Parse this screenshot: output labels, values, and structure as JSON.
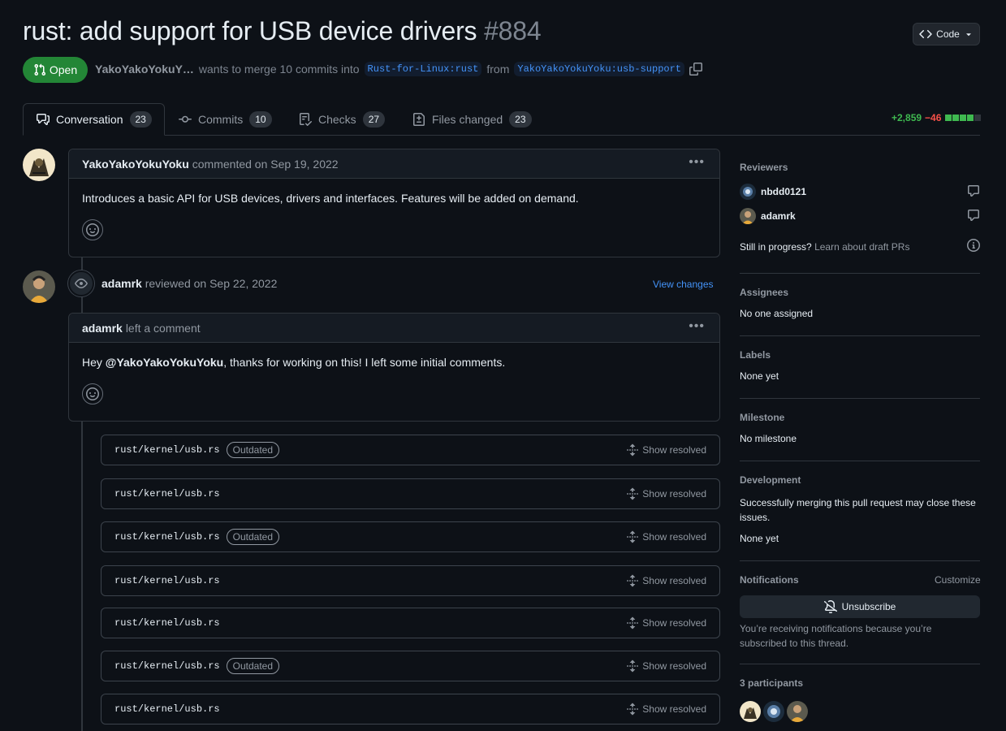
{
  "pr": {
    "title": "rust: add support for USB device drivers",
    "number": "#884",
    "state": "Open",
    "author": "YakoYakoYokuY…",
    "merge_text": "wants to merge 10 commits into",
    "base_branch": "Rust-for-Linux:rust",
    "from_text": "from",
    "head_branch": "YakoYakoYokuYoku:usb-support",
    "code_button": "Code"
  },
  "tabs": [
    {
      "label": "Conversation",
      "count": "23",
      "icon": "comment-discussion-icon"
    },
    {
      "label": "Commits",
      "count": "10",
      "icon": "git-commit-icon"
    },
    {
      "label": "Checks",
      "count": "27",
      "icon": "checklist-icon"
    },
    {
      "label": "Files changed",
      "count": "23",
      "icon": "file-diff-icon"
    }
  ],
  "diffstat": {
    "additions": "+2,859",
    "deletions": "−46"
  },
  "timeline": {
    "comment1": {
      "author": "YakoYakoYokuYoku",
      "action": "commented on Sep 19, 2022",
      "body": "Introduces a basic API for USB devices, drivers and interfaces. Features will be added on demand."
    },
    "review": {
      "author": "adamrk",
      "action": "reviewed on Sep 22, 2022",
      "view_changes": "View changes"
    },
    "comment2": {
      "author": "adamrk",
      "action": "left a comment",
      "body_pre": "Hey ",
      "mention": "@YakoYakoYokuYoku",
      "body_post": ", thanks for working on this! I left some initial comments."
    },
    "threads": [
      {
        "path": "rust/kernel/usb.rs",
        "outdated": "Outdated",
        "action": "Show resolved"
      },
      {
        "path": "rust/kernel/usb.rs",
        "outdated": "",
        "action": "Show resolved"
      },
      {
        "path": "rust/kernel/usb.rs",
        "outdated": "Outdated",
        "action": "Show resolved"
      },
      {
        "path": "rust/kernel/usb.rs",
        "outdated": "",
        "action": "Show resolved"
      },
      {
        "path": "rust/kernel/usb.rs",
        "outdated": "",
        "action": "Show resolved"
      },
      {
        "path": "rust/kernel/usb.rs",
        "outdated": "Outdated",
        "action": "Show resolved"
      },
      {
        "path": "rust/kernel/usb.rs",
        "outdated": "",
        "action": "Show resolved"
      }
    ]
  },
  "sidebar": {
    "reviewers": {
      "heading": "Reviewers",
      "items": [
        {
          "name": "nbdd0121"
        },
        {
          "name": "adamrk"
        }
      ],
      "draft_text": "Still in progress?",
      "draft_link": "Learn about draft PRs"
    },
    "assignees": {
      "heading": "Assignees",
      "value": "No one assigned"
    },
    "labels": {
      "heading": "Labels",
      "value": "None yet"
    },
    "milestone": {
      "heading": "Milestone",
      "value": "No milestone"
    },
    "development": {
      "heading": "Development",
      "text": "Successfully merging this pull request may close these issues.",
      "value": "None yet"
    },
    "notifications": {
      "heading": "Notifications",
      "customize": "Customize",
      "button": "Unsubscribe",
      "note": "You’re receiving notifications because you’re subscribed to this thread."
    },
    "participants": {
      "heading": "3 participants"
    }
  },
  "colors": {
    "accent": "#4493f8",
    "open": "#238636",
    "add": "#3fb950",
    "del": "#f85149"
  }
}
